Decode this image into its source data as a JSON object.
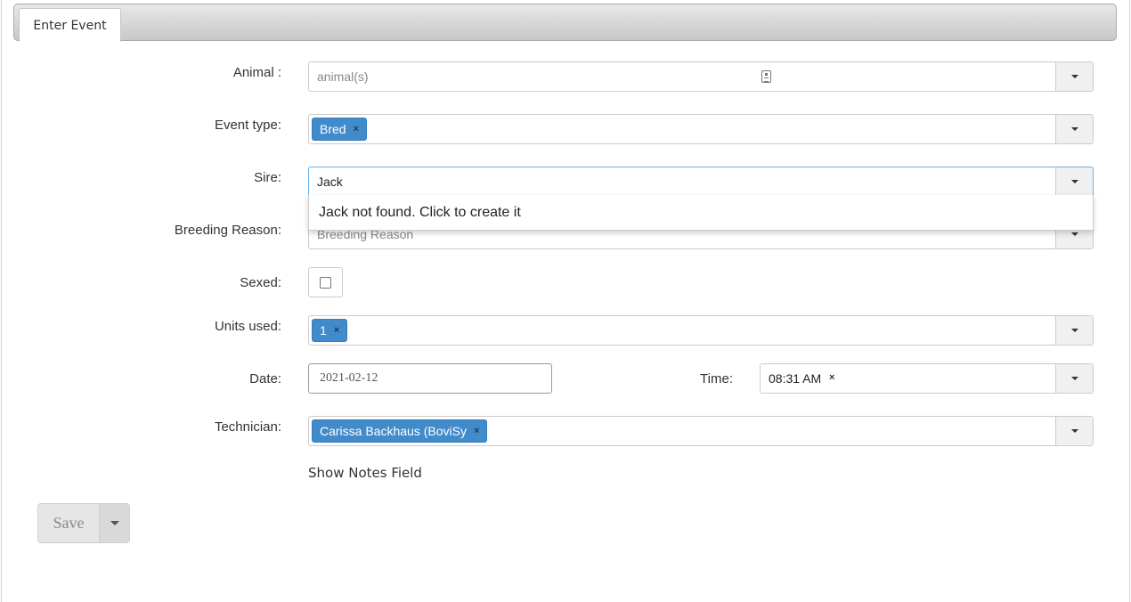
{
  "tabs": [
    {
      "label": "Enter Event"
    }
  ],
  "form": {
    "animal": {
      "label": "Animal :",
      "placeholder": "animal(s)"
    },
    "event_type": {
      "label": "Event type:",
      "chips": [
        "Bred"
      ]
    },
    "sire": {
      "label": "Sire:",
      "value": "Jack",
      "suggestion": "Jack not found. Click to create it"
    },
    "breeding_reason": {
      "label": "Breeding Reason:",
      "placeholder": "Breeding Reason"
    },
    "sexed": {
      "label": "Sexed:",
      "checked": false
    },
    "units_used": {
      "label": "Units used:",
      "chips": [
        "1"
      ]
    },
    "date": {
      "label": "Date:",
      "value": "2021-02-12"
    },
    "time": {
      "label": "Time:",
      "value": "08:31 AM"
    },
    "technician": {
      "label": "Technician:",
      "chips": [
        "Carissa Backhaus (BoviSy"
      ]
    },
    "notes_link": "Show Notes Field"
  },
  "actions": {
    "save_label": "Save"
  },
  "icons": {
    "chip_remove": "×",
    "dropdown": "caret-down-icon",
    "scan": "barcode-scan-icon"
  },
  "colors": {
    "chip_bg": "#428bca",
    "tab_bar": "#d0d0d0",
    "focus_border": "#66afe9"
  }
}
